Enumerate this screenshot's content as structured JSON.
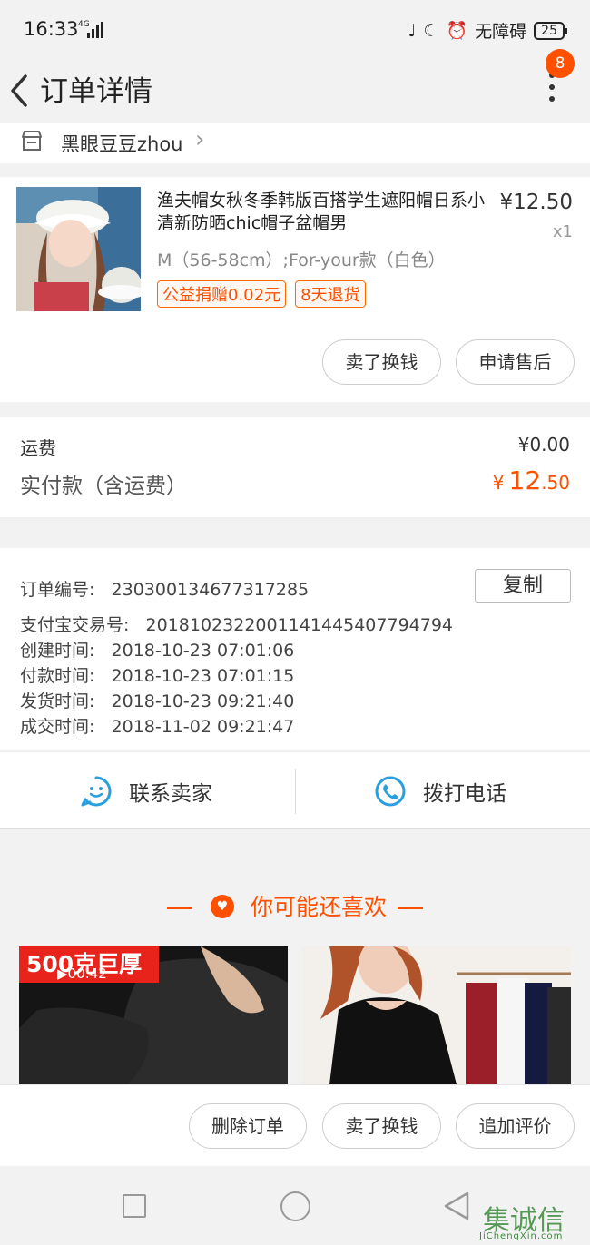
{
  "status_bar": {
    "time": "16:33",
    "network": "4G",
    "accessibility": "无障碍",
    "battery": "25"
  },
  "header": {
    "title": "订单详情",
    "notification_count": "8"
  },
  "shop": {
    "name": "黑眼豆豆zhou"
  },
  "product": {
    "title": "渔夫帽女秋冬季韩版百搭学生遮阳帽日系小清新防晒chic帽子盆帽男",
    "price": "¥12.50",
    "quantity": "x1",
    "sku": "M（56-58cm）;For-your款（白色）",
    "tags": [
      "公益捐赠0.02元",
      "8天退货"
    ],
    "actions": [
      "卖了换钱",
      "申请售后"
    ]
  },
  "fees": {
    "shipping_label": "运费",
    "shipping_value": "¥0.00",
    "paid_label": "实付款（含运费）",
    "paid_currency": "¥",
    "paid_int": "12",
    "paid_dec": ".50"
  },
  "order_info": {
    "copy_label": "复制",
    "rows": [
      {
        "key": "订单编号:",
        "value": "230300134677317285"
      },
      {
        "key": "支付宝交易号:",
        "value": "2018102322001141445407794794"
      },
      {
        "key": "创建时间:",
        "value": "2018-10-23 07:01:06"
      },
      {
        "key": "付款时间:",
        "value": "2018-10-23 07:01:15"
      },
      {
        "key": "发货时间:",
        "value": "2018-10-23 09:21:40"
      },
      {
        "key": "成交时间:",
        "value": "2018-11-02 09:21:47"
      }
    ]
  },
  "contact": {
    "seller": "联系卖家",
    "phone": "拨打电话"
  },
  "recommend": {
    "title": "你可能还喜欢",
    "items": [
      {
        "promo": "500克巨厚",
        "video_time": "00:42"
      },
      {}
    ]
  },
  "bottom_actions": [
    "删除订单",
    "卖了换钱",
    "追加评价"
  ],
  "watermark": {
    "text": "集诚信",
    "sub": "JiChengXin.com"
  },
  "colors": {
    "accent": "#ff5000",
    "background": "#f2f2f2"
  }
}
